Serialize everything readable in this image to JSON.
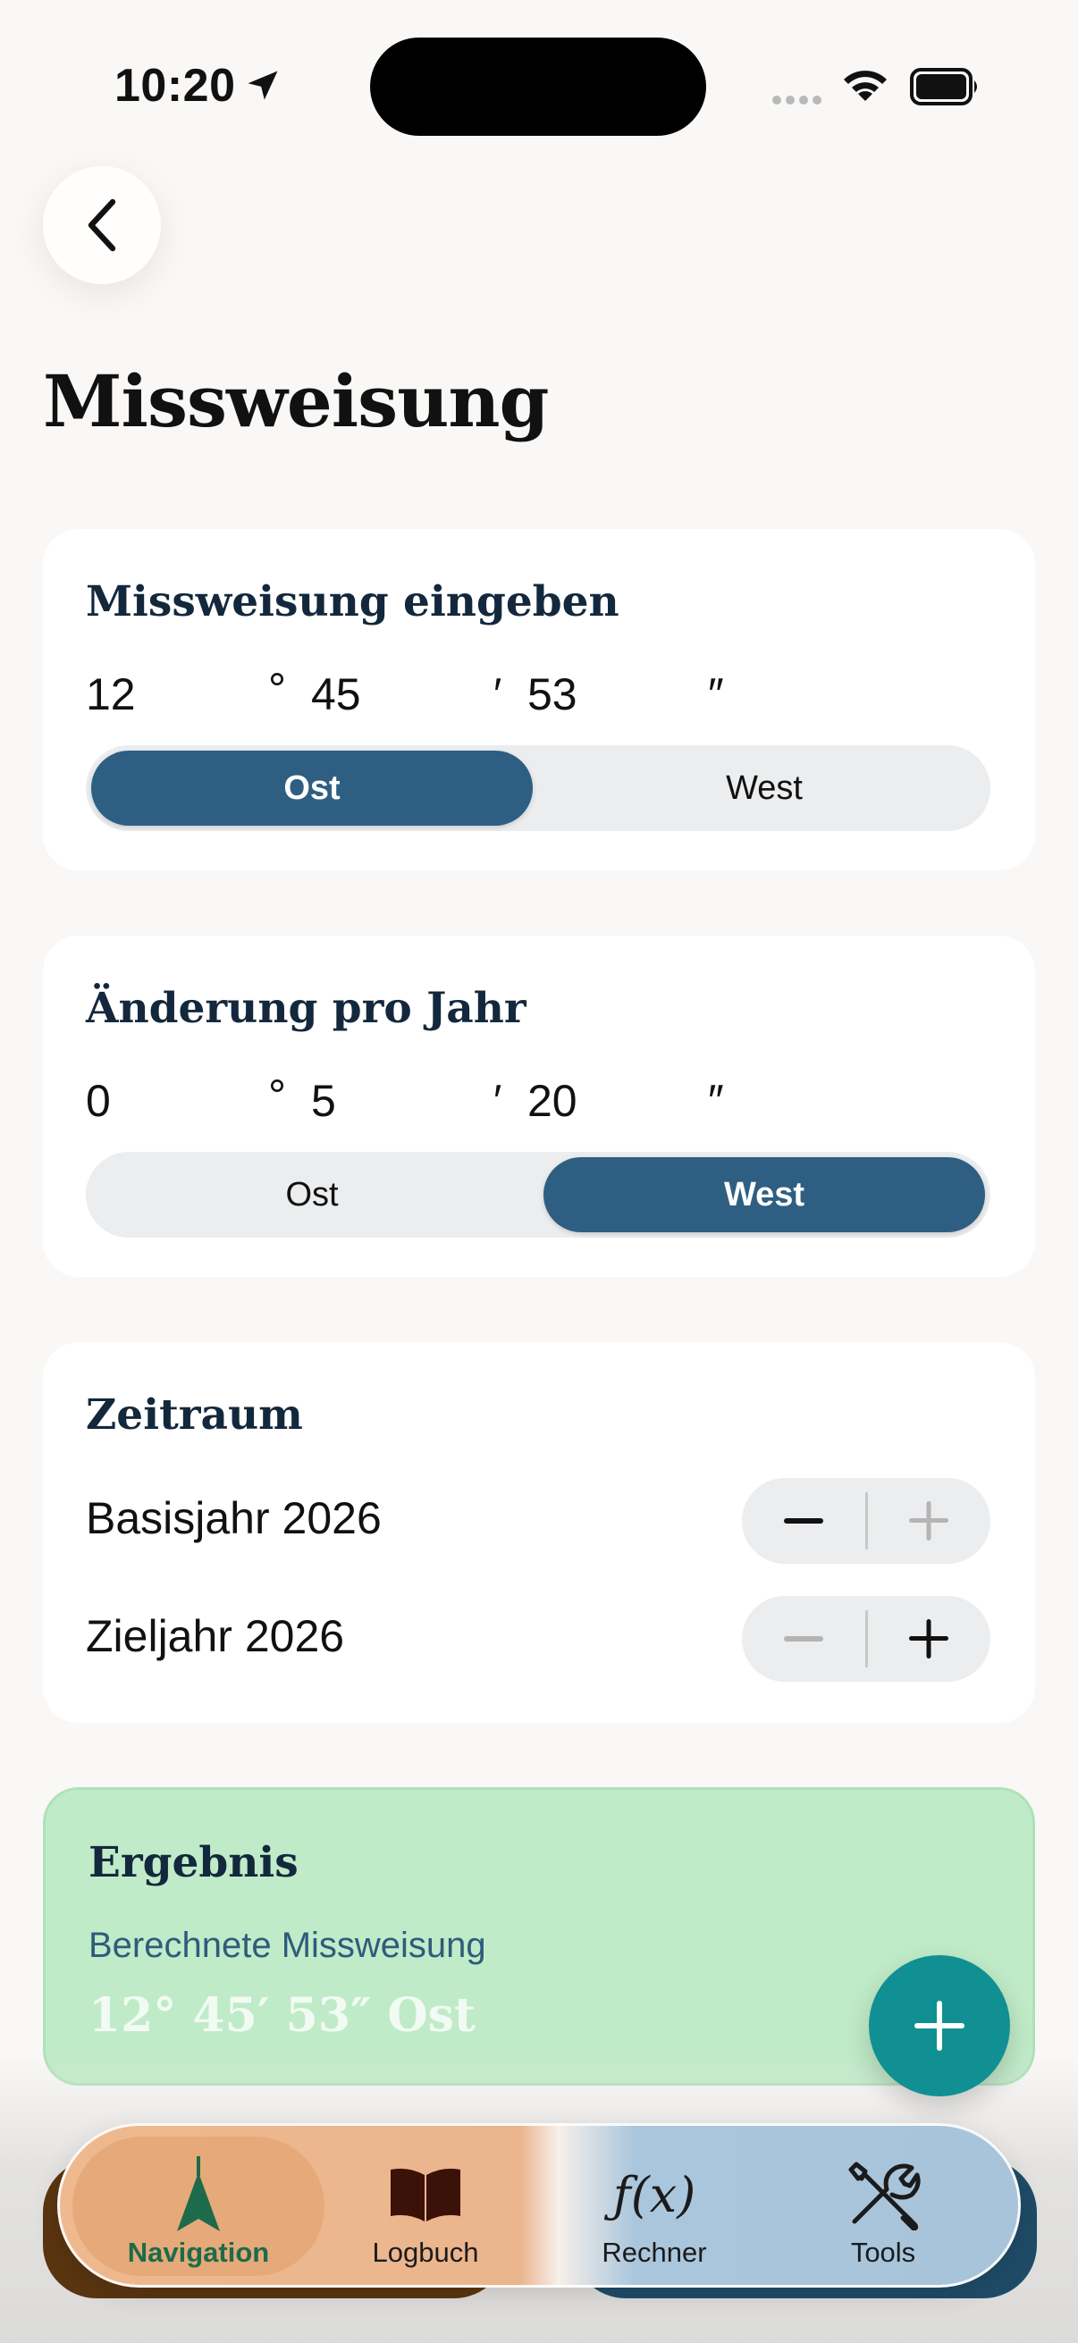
{
  "status_bar": {
    "time": "10:20"
  },
  "page": {
    "title": "Missweisung"
  },
  "declination_card": {
    "title": "Missweisung eingeben",
    "degrees": "12",
    "degree_symbol": "°",
    "minutes": "45",
    "minute_symbol": "′",
    "seconds": "53",
    "second_symbol": "″",
    "options": [
      "Ost",
      "West"
    ],
    "selected": "Ost"
  },
  "change_card": {
    "title": "Änderung pro Jahr",
    "degrees": "0",
    "degree_symbol": "°",
    "minutes": "5",
    "minute_symbol": "′",
    "seconds": "20",
    "second_symbol": "″",
    "options": [
      "Ost",
      "West"
    ],
    "selected": "West"
  },
  "period_card": {
    "title": "Zeitraum",
    "base_year_label": "Basisjahr 2026",
    "target_year_label": "Zieljahr 2026"
  },
  "result_card": {
    "title": "Ergebnis",
    "subtitle": "Berechnete Missweisung",
    "value": "12° 45′ 53″ Ost"
  },
  "tabbar": {
    "items": [
      {
        "label": "Navigation",
        "icon": "navigation-arrow-icon"
      },
      {
        "label": "Logbuch",
        "icon": "book-icon"
      },
      {
        "label": "Rechner",
        "icon": "function-icon",
        "glyph": "ƒ(x)"
      },
      {
        "label": "Tools",
        "icon": "tools-icon"
      }
    ],
    "active": "Navigation"
  },
  "colors": {
    "accent": "#2e5f82",
    "fab": "#109092",
    "result_bg": "#c0ebc8",
    "nav_active": "#1d6b4a"
  }
}
